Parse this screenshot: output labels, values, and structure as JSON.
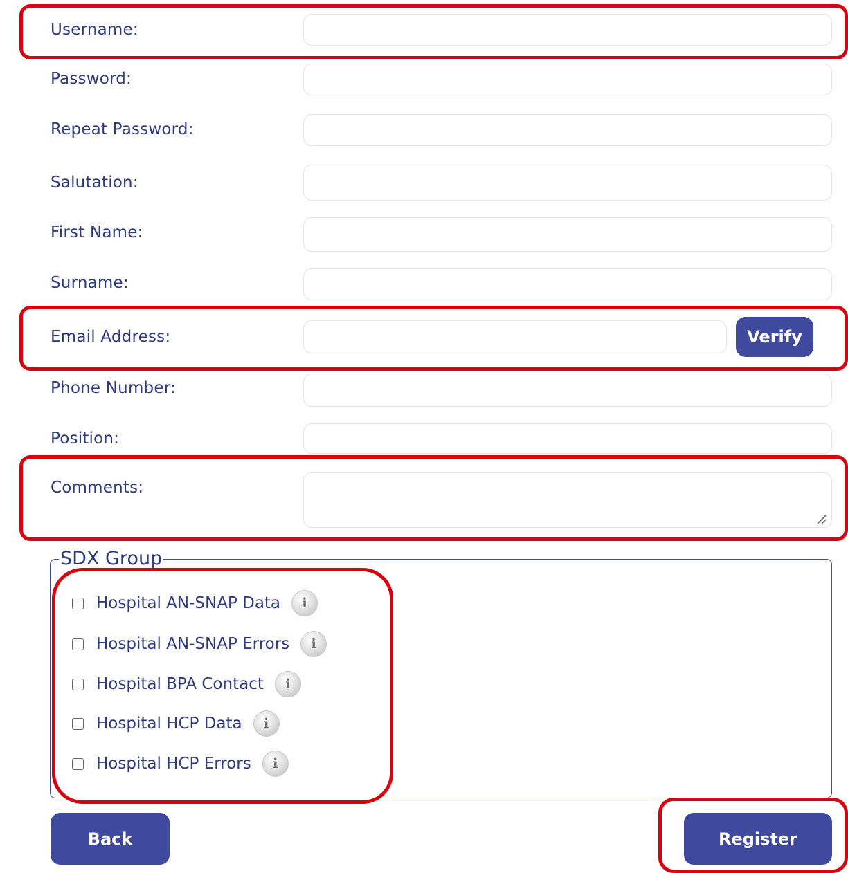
{
  "fields": {
    "username": {
      "label": "Username:",
      "value": ""
    },
    "password": {
      "label": "Password:",
      "value": ""
    },
    "repeat_password": {
      "label": "Repeat Password:",
      "value": ""
    },
    "salutation": {
      "label": "Salutation:",
      "value": ""
    },
    "first_name": {
      "label": "First Name:",
      "value": ""
    },
    "surname": {
      "label": "Surname:",
      "value": ""
    },
    "email": {
      "label": "Email Address:",
      "value": "",
      "verify_label": "Verify"
    },
    "phone": {
      "label": "Phone Number:",
      "value": ""
    },
    "position": {
      "label": "Position:",
      "value": ""
    },
    "comments": {
      "label": "Comments:",
      "value": ""
    }
  },
  "sdx_group": {
    "legend": "SDX Group",
    "info_glyph": "i",
    "options": [
      {
        "label": "Hospital AN-SNAP Data",
        "checked": false
      },
      {
        "label": "Hospital AN-SNAP Errors",
        "checked": false
      },
      {
        "label": "Hospital BPA Contact",
        "checked": false
      },
      {
        "label": "Hospital HCP Data",
        "checked": false
      },
      {
        "label": "Hospital HCP Errors",
        "checked": false
      }
    ]
  },
  "buttons": {
    "back": "Back",
    "register": "Register"
  },
  "colors": {
    "primary": "#3f4a9e",
    "label_text": "#2e3a80",
    "highlight": "#d7000f"
  }
}
